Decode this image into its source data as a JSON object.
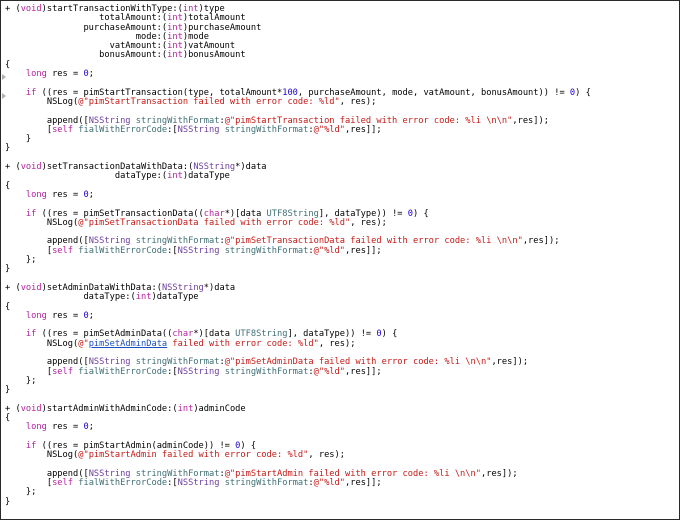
{
  "colors": {
    "keyword": "#b5239f",
    "class": "#6d3f9c",
    "selector": "#3f6f74",
    "string": "#c41a16",
    "number": "#1c00cf",
    "link": "#1c4fbf",
    "plain": "#000000"
  },
  "icons": {
    "fold_marker": "fold-triangle-icon"
  },
  "code_lines": [
    [
      [
        "p",
        "+ ("
      ],
      [
        "k",
        "void"
      ],
      [
        "p",
        ")startTransactionWithType:("
      ],
      [
        "k",
        "int"
      ],
      [
        "p",
        ")type"
      ]
    ],
    [
      [
        "p",
        "                  totalAmount:("
      ],
      [
        "k",
        "int"
      ],
      [
        "p",
        ")totalAmount"
      ]
    ],
    [
      [
        "p",
        "               purchaseAmount:("
      ],
      [
        "k",
        "int"
      ],
      [
        "p",
        ")purchaseAmount"
      ]
    ],
    [
      [
        "p",
        "                         mode:("
      ],
      [
        "k",
        "int"
      ],
      [
        "p",
        ")mode"
      ]
    ],
    [
      [
        "p",
        "                    vatAmount:("
      ],
      [
        "k",
        "int"
      ],
      [
        "p",
        ")vatAmount"
      ]
    ],
    [
      [
        "p",
        "                  bonusAmount:("
      ],
      [
        "k",
        "int"
      ],
      [
        "p",
        ")bonusAmount"
      ]
    ],
    [
      [
        "p",
        "{"
      ]
    ],
    [
      [
        "p",
        "    "
      ],
      [
        "k",
        "long"
      ],
      [
        "p",
        " res = "
      ],
      [
        "n",
        "0"
      ],
      [
        "p",
        ";"
      ]
    ],
    [
      [
        "p",
        ""
      ]
    ],
    [
      [
        "p",
        "    "
      ],
      [
        "k",
        "if"
      ],
      [
        "p",
        " ((res = pimStartTransaction(type, totalAmount*"
      ],
      [
        "n",
        "100"
      ],
      [
        "p",
        ", purchaseAmount, mode, vatAmount, bonusAmount)) != "
      ],
      [
        "n",
        "0"
      ],
      [
        "p",
        ") {"
      ]
    ],
    [
      [
        "p",
        "        NSLog("
      ],
      [
        "s",
        "@\"pimStartTransaction failed with error code: %ld\""
      ],
      [
        "p",
        ", res);"
      ]
    ],
    [
      [
        "p",
        ""
      ]
    ],
    [
      [
        "p",
        "        append(["
      ],
      [
        "c",
        "NSString"
      ],
      [
        "p",
        " "
      ],
      [
        "m",
        "stringWithFormat"
      ],
      [
        "p",
        ":"
      ],
      [
        "s",
        "@\"pimStartTransaction failed with error code: %li \\n\\n\""
      ],
      [
        "p",
        ",res]);"
      ]
    ],
    [
      [
        "p",
        "        ["
      ],
      [
        "k",
        "self"
      ],
      [
        "p",
        " "
      ],
      [
        "m",
        "fialWithErrorCode"
      ],
      [
        "p",
        ":["
      ],
      [
        "c",
        "NSString"
      ],
      [
        "p",
        " "
      ],
      [
        "m",
        "stringWithFormat"
      ],
      [
        "p",
        ":"
      ],
      [
        "s",
        "@\"%ld\""
      ],
      [
        "p",
        ",res]];"
      ]
    ],
    [
      [
        "p",
        "    }"
      ]
    ],
    [
      [
        "p",
        "}"
      ]
    ],
    [
      [
        "p",
        ""
      ]
    ],
    [
      [
        "p",
        "+ ("
      ],
      [
        "k",
        "void"
      ],
      [
        "p",
        ")setTransactionDataWithData:("
      ],
      [
        "c",
        "NSString"
      ],
      [
        "p",
        "*)data"
      ]
    ],
    [
      [
        "p",
        "                     dataType:("
      ],
      [
        "k",
        "int"
      ],
      [
        "p",
        ")dataType"
      ]
    ],
    [
      [
        "p",
        "{"
      ]
    ],
    [
      [
        "p",
        "    "
      ],
      [
        "k",
        "long"
      ],
      [
        "p",
        " res = "
      ],
      [
        "n",
        "0"
      ],
      [
        "p",
        ";"
      ]
    ],
    [
      [
        "p",
        ""
      ]
    ],
    [
      [
        "p",
        "    "
      ],
      [
        "k",
        "if"
      ],
      [
        "p",
        " ((res = pimSetTransactionData(("
      ],
      [
        "k",
        "char"
      ],
      [
        "p",
        "*)[data "
      ],
      [
        "m",
        "UTF8String"
      ],
      [
        "p",
        "], dataType)) != "
      ],
      [
        "n",
        "0"
      ],
      [
        "p",
        ") {"
      ]
    ],
    [
      [
        "p",
        "        NSLog("
      ],
      [
        "s",
        "@\"pimSetTransactionData failed with error code: %ld\""
      ],
      [
        "p",
        ", res);"
      ]
    ],
    [
      [
        "p",
        ""
      ]
    ],
    [
      [
        "p",
        "        append(["
      ],
      [
        "c",
        "NSString"
      ],
      [
        "p",
        " "
      ],
      [
        "m",
        "stringWithFormat"
      ],
      [
        "p",
        ":"
      ],
      [
        "s",
        "@\"pimSetTransactionData failed with error code: %li \\n\\n\""
      ],
      [
        "p",
        ",res]);"
      ]
    ],
    [
      [
        "p",
        "        ["
      ],
      [
        "k",
        "self"
      ],
      [
        "p",
        " "
      ],
      [
        "m",
        "fialWithErrorCode"
      ],
      [
        "p",
        ":["
      ],
      [
        "c",
        "NSString"
      ],
      [
        "p",
        " "
      ],
      [
        "m",
        "stringWithFormat"
      ],
      [
        "p",
        ":"
      ],
      [
        "s",
        "@\"%ld\""
      ],
      [
        "p",
        ",res]];"
      ]
    ],
    [
      [
        "p",
        "    };"
      ]
    ],
    [
      [
        "p",
        "}"
      ]
    ],
    [
      [
        "p",
        ""
      ]
    ],
    [
      [
        "p",
        "+ ("
      ],
      [
        "k",
        "void"
      ],
      [
        "p",
        ")setAdminDataWithData:("
      ],
      [
        "c",
        "NSString"
      ],
      [
        "p",
        "*)data"
      ]
    ],
    [
      [
        "p",
        "               dataType:("
      ],
      [
        "k",
        "int"
      ],
      [
        "p",
        ")dataType"
      ]
    ],
    [
      [
        "p",
        "{"
      ]
    ],
    [
      [
        "p",
        "    "
      ],
      [
        "k",
        "long"
      ],
      [
        "p",
        " res = "
      ],
      [
        "n",
        "0"
      ],
      [
        "p",
        ";"
      ]
    ],
    [
      [
        "p",
        ""
      ]
    ],
    [
      [
        "p",
        "    "
      ],
      [
        "k",
        "if"
      ],
      [
        "p",
        " ((res = pimSetAdminData(("
      ],
      [
        "k",
        "char"
      ],
      [
        "p",
        "*)[data "
      ],
      [
        "m",
        "UTF8String"
      ],
      [
        "p",
        "], dataType)) != "
      ],
      [
        "n",
        "0"
      ],
      [
        "p",
        ") {"
      ]
    ],
    [
      [
        "p",
        "        NSLog("
      ],
      [
        "s",
        "@\""
      ],
      [
        "u",
        "pimSetAdminData"
      ],
      [
        "s",
        " failed with error code: %ld\""
      ],
      [
        "p",
        ", res);"
      ]
    ],
    [
      [
        "p",
        ""
      ]
    ],
    [
      [
        "p",
        "        append(["
      ],
      [
        "c",
        "NSString"
      ],
      [
        "p",
        " "
      ],
      [
        "m",
        "stringWithFormat"
      ],
      [
        "p",
        ":"
      ],
      [
        "s",
        "@\"pimSetAdminData failed with error code: %li \\n\\n\""
      ],
      [
        "p",
        ",res]);"
      ]
    ],
    [
      [
        "p",
        "        ["
      ],
      [
        "k",
        "self"
      ],
      [
        "p",
        " "
      ],
      [
        "m",
        "fialWithErrorCode"
      ],
      [
        "p",
        ":["
      ],
      [
        "c",
        "NSString"
      ],
      [
        "p",
        " "
      ],
      [
        "m",
        "stringWithFormat"
      ],
      [
        "p",
        ":"
      ],
      [
        "s",
        "@\"%ld\""
      ],
      [
        "p",
        ",res]];"
      ]
    ],
    [
      [
        "p",
        "    };"
      ]
    ],
    [
      [
        "p",
        "}"
      ]
    ],
    [
      [
        "p",
        ""
      ]
    ],
    [
      [
        "p",
        "+ ("
      ],
      [
        "k",
        "void"
      ],
      [
        "p",
        ")startAdminWithAdminCode:("
      ],
      [
        "k",
        "int"
      ],
      [
        "p",
        ")adminCode"
      ]
    ],
    [
      [
        "p",
        "{"
      ]
    ],
    [
      [
        "p",
        "    "
      ],
      [
        "k",
        "long"
      ],
      [
        "p",
        " res = "
      ],
      [
        "n",
        "0"
      ],
      [
        "p",
        ";"
      ]
    ],
    [
      [
        "p",
        ""
      ]
    ],
    [
      [
        "p",
        "    "
      ],
      [
        "k",
        "if"
      ],
      [
        "p",
        " ((res = pimStartAdmin(adminCode)) != "
      ],
      [
        "n",
        "0"
      ],
      [
        "p",
        ") {"
      ]
    ],
    [
      [
        "p",
        "        NSLog("
      ],
      [
        "s",
        "@\"pimStartAdmin failed with error code: %ld\""
      ],
      [
        "p",
        ", res);"
      ]
    ],
    [
      [
        "p",
        ""
      ]
    ],
    [
      [
        "p",
        "        append(["
      ],
      [
        "c",
        "NSString"
      ],
      [
        "p",
        " "
      ],
      [
        "m",
        "stringWithFormat"
      ],
      [
        "p",
        ":"
      ],
      [
        "s",
        "@\"pimStartAdmin failed with error code: %li \\n\\n\""
      ],
      [
        "p",
        ",res]);"
      ]
    ],
    [
      [
        "p",
        "        ["
      ],
      [
        "k",
        "self"
      ],
      [
        "p",
        " "
      ],
      [
        "m",
        "fialWithErrorCode"
      ],
      [
        "p",
        ":["
      ],
      [
        "c",
        "NSString"
      ],
      [
        "p",
        " "
      ],
      [
        "m",
        "stringWithFormat"
      ],
      [
        "p",
        ":"
      ],
      [
        "s",
        "@\"%ld\""
      ],
      [
        "p",
        ",res]];"
      ]
    ],
    [
      [
        "p",
        "    };"
      ]
    ],
    [
      [
        "p",
        "}"
      ]
    ]
  ]
}
